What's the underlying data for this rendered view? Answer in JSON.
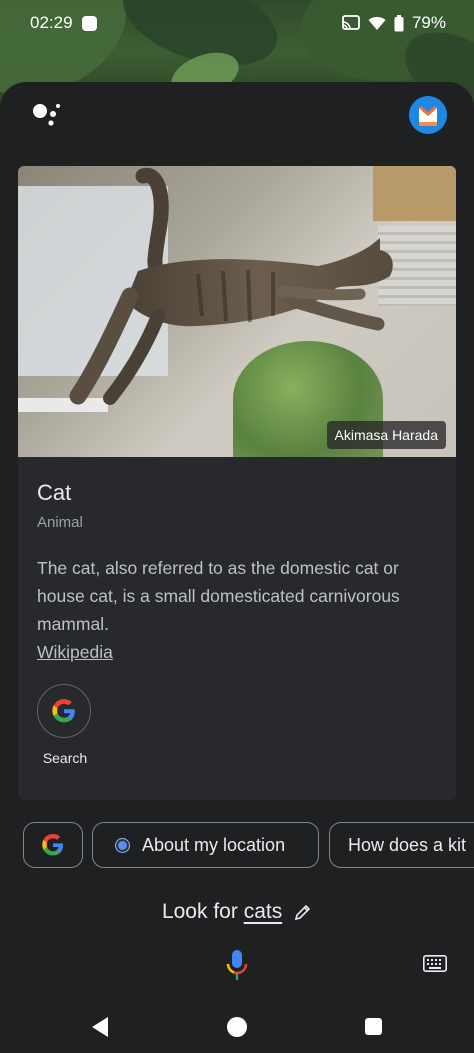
{
  "status_bar": {
    "time": "02:29",
    "battery": "79%"
  },
  "card": {
    "image_credit": "Akimasa Harada",
    "title": "Cat",
    "subtitle": "Animal",
    "description": "The cat, also referred to as the domestic cat or house cat, is a small domesticated carnivorous mammal.",
    "source_link": "Wikipedia",
    "search_label": "Search"
  },
  "suggestions": [
    {
      "label": "About my location"
    },
    {
      "label": "How does a kit"
    }
  ],
  "query": {
    "prefix": "Look for",
    "term": "cats"
  },
  "icons": {
    "assistant": "google-assistant-icon",
    "account": "account-avatar-icon",
    "google": "google-g-icon",
    "mic": "microphone-icon",
    "keyboard": "keyboard-icon",
    "edit": "pencil-icon"
  },
  "colors": {
    "sheet_background": "#1f2022",
    "card_background": "#28292c",
    "google_blue": "#4285f4",
    "google_red": "#ea4335",
    "google_yellow": "#fbbc05",
    "google_green": "#34a853"
  }
}
